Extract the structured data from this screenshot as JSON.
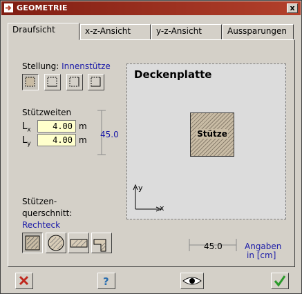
{
  "window": {
    "title": "GEOMETRIE",
    "close_label": "x"
  },
  "tabs": [
    {
      "label": "Draufsicht",
      "active": true
    },
    {
      "label": "x-z-Ansicht",
      "active": false
    },
    {
      "label": "y-z-Ansicht",
      "active": false
    },
    {
      "label": "Aussparungen",
      "active": false
    }
  ],
  "stellung": {
    "label": "Stellung:",
    "value": "Innenstütze",
    "options": [
      "innen",
      "rand",
      "rand-zwei",
      "ecke"
    ]
  },
  "stuetzweiten": {
    "label": "Stützweiten",
    "lx_label": "L",
    "lx_sub": "x",
    "lx_value": "4.00",
    "lx_unit": "m",
    "ly_label": "L",
    "ly_sub": "y",
    "ly_value": "4.00",
    "ly_unit": "m",
    "dim_value": "45.0"
  },
  "querschnitt": {
    "label_line1": "Stützen-",
    "label_line2": "querschnitt:",
    "value": "Rechteck",
    "options": [
      "rechteck",
      "kreis",
      "rechteck-liegend",
      "sonderform"
    ]
  },
  "preview": {
    "title": "Deckenplatte",
    "column_label": "Stütze",
    "axis_x": "x",
    "axis_y": "y",
    "dim_value": "45.0",
    "note_line1": "Angaben",
    "note_line2": "in [cm]"
  },
  "colors": {
    "accent": "#1a1aa8",
    "title_bar": "#7f1d12",
    "input_bg": "#ffffcc"
  }
}
